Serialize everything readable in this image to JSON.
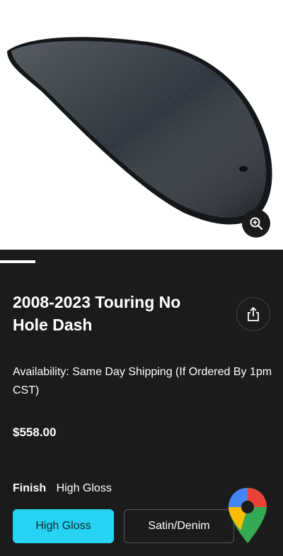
{
  "product": {
    "image_alt": "Carbon fiber dash",
    "title": "2008-2023 Touring No Hole Dash",
    "availability": "Availability: Same Day Shipping (If Ordered By 1pm CST)",
    "price": "$558.00"
  },
  "gallery": {
    "progress_fraction": 0.125
  },
  "finish": {
    "label": "Finish",
    "selected": "High Gloss",
    "options": [
      "High Gloss",
      "Satin/Denim"
    ]
  },
  "icons": {
    "zoom": "zoom-in-icon",
    "share": "share-icon",
    "maps": "google-maps-pin-icon"
  },
  "colors": {
    "background": "#1b1b1b",
    "accent": "#27d3f2",
    "text": "#ffffff"
  }
}
